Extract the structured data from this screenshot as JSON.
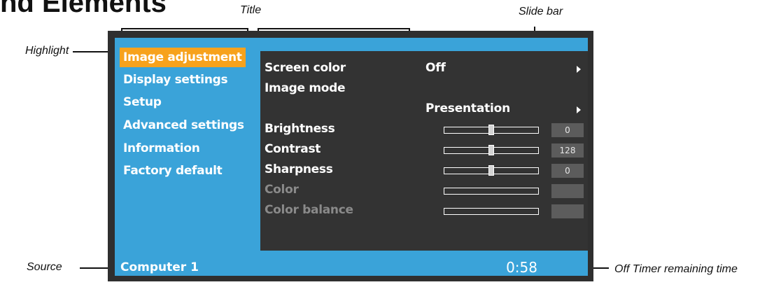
{
  "heading": "nd Elements",
  "annotations": {
    "title": "Title",
    "slide_bar": "Slide bar",
    "highlight": "Highlight",
    "source": "Source",
    "off_timer": "Off Timer remaining time"
  },
  "sidebar": {
    "items": [
      {
        "label": "Image adjustment",
        "active": true
      },
      {
        "label": "Display settings",
        "active": false
      },
      {
        "label": "Setup",
        "active": false
      },
      {
        "label": "Advanced settings",
        "active": false
      },
      {
        "label": "Information",
        "active": false
      },
      {
        "label": "Factory default",
        "active": false
      }
    ]
  },
  "panel": {
    "screen_color": {
      "label": "Screen color",
      "value": "Off"
    },
    "image_mode": {
      "label": "Image mode",
      "value": "Presentation"
    },
    "sliders": [
      {
        "label": "Brightness",
        "value": "0",
        "level": 0.5,
        "enabled": true
      },
      {
        "label": "Contrast",
        "value": "128",
        "level": 0.5,
        "enabled": true
      },
      {
        "label": "Sharpness",
        "value": "0",
        "level": 0.5,
        "enabled": true
      },
      {
        "label": "Color",
        "value": "",
        "level": null,
        "enabled": false
      },
      {
        "label": "Color balance",
        "value": "",
        "level": null,
        "enabled": false
      }
    ]
  },
  "status": {
    "source": "Computer 1",
    "timer": "0:58"
  },
  "colors": {
    "highlight": "#f7a21c",
    "menu_bg": "#3aa3d9",
    "panel_bg": "#333333",
    "frame": "#2f2f2f"
  }
}
